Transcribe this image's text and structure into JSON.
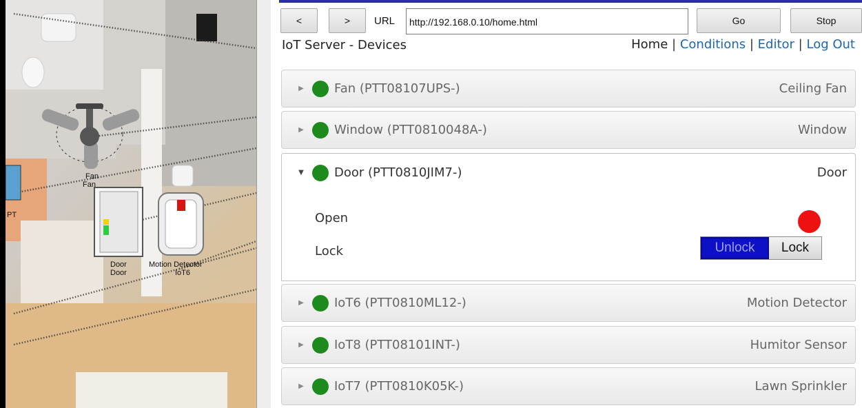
{
  "floorplan": {
    "labels": {
      "fan_top": "Fan",
      "fan_bottom": "Fan",
      "pt": "PT",
      "door_top": "Door",
      "door_bottom": "Door",
      "motion_top": "Motion Detector",
      "motion_bottom": "IoT6"
    }
  },
  "browser": {
    "back_label": "<",
    "forward_label": ">",
    "url_label": "URL",
    "url_value": "http://192.168.0.10/home.html",
    "go_label": "Go",
    "stop_label": "Stop"
  },
  "page": {
    "title": "IoT Server - Devices",
    "nav": {
      "home": "Home",
      "conditions": "Conditions",
      "editor": "Editor",
      "logout": "Log Out",
      "separator": "|"
    }
  },
  "devices": [
    {
      "name": "Fan (PTT08107UPS-)",
      "type": "Ceiling Fan",
      "status_color": "#1d8a1d",
      "expanded": false
    },
    {
      "name": "Window (PTT0810048A-)",
      "type": "Window",
      "status_color": "#1d8a1d",
      "expanded": false
    },
    {
      "name": "Door (PTT0810JIM7-)",
      "type": "Door",
      "status_color": "#1d8a1d",
      "expanded": true
    },
    {
      "name": "IoT6 (PTT0810ML12-)",
      "type": "Motion Detector",
      "status_color": "#1d8a1d",
      "expanded": false
    },
    {
      "name": "IoT8 (PTT08101INT-)",
      "type": "Humitor Sensor",
      "status_color": "#1d8a1d",
      "expanded": false
    },
    {
      "name": "IoT7 (PTT0810K05K-)",
      "type": "Lawn Sprinkler",
      "status_color": "#1d8a1d",
      "expanded": false
    }
  ],
  "door_details": {
    "open_label": "Open",
    "open_status_color": "#ee1111",
    "lock_label": "Lock",
    "unlock_button": "Unlock",
    "lock_button": "Lock",
    "selected": "Unlock"
  },
  "icons": {
    "collapsed": "triangle-right-icon",
    "expanded": "triangle-down-icon",
    "status": "status-dot-icon"
  }
}
